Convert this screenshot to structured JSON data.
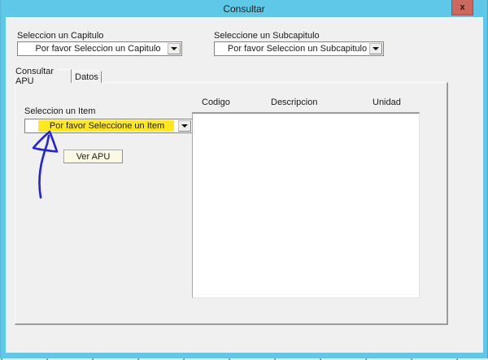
{
  "window": {
    "title": "Consultar",
    "close_label": "x"
  },
  "top_section": {
    "capitulo_label": "Seleccion un Capitulo",
    "capitulo_value": "Por favor Seleccion un Capitulo",
    "subcapitulo_label": "Seleccione un Subcapitulo",
    "subcapitulo_value": "Por favor Seleccion un Subcapitulo"
  },
  "tabs": [
    {
      "label": "Consultar APU",
      "active": true
    },
    {
      "label": "Datos",
      "active": false
    }
  ],
  "tab_page": {
    "item_label": "Seleccion un Item",
    "item_value": "Por favor Seleccione un Item",
    "ver_apu_button": "Ver APU",
    "list_headers": [
      "Codigo",
      "Descripcion",
      "Unidad"
    ],
    "list_rows": []
  },
  "annotation": {
    "type": "hand-drawn-arrow",
    "points_to": "item-combobox",
    "color": "#2222DD"
  },
  "colors": {
    "titlebar_blue": "#5FC8E9",
    "window_border_blue": "#5FC8E9",
    "dialog_bg": "#F0F0F0",
    "close_button_bg": "#CE675E",
    "close_button_border": "#A34A42",
    "highlight_yellow": "#FFE81C",
    "button_cream": "#FBF8E3",
    "annotation_blue": "#2222DD"
  }
}
